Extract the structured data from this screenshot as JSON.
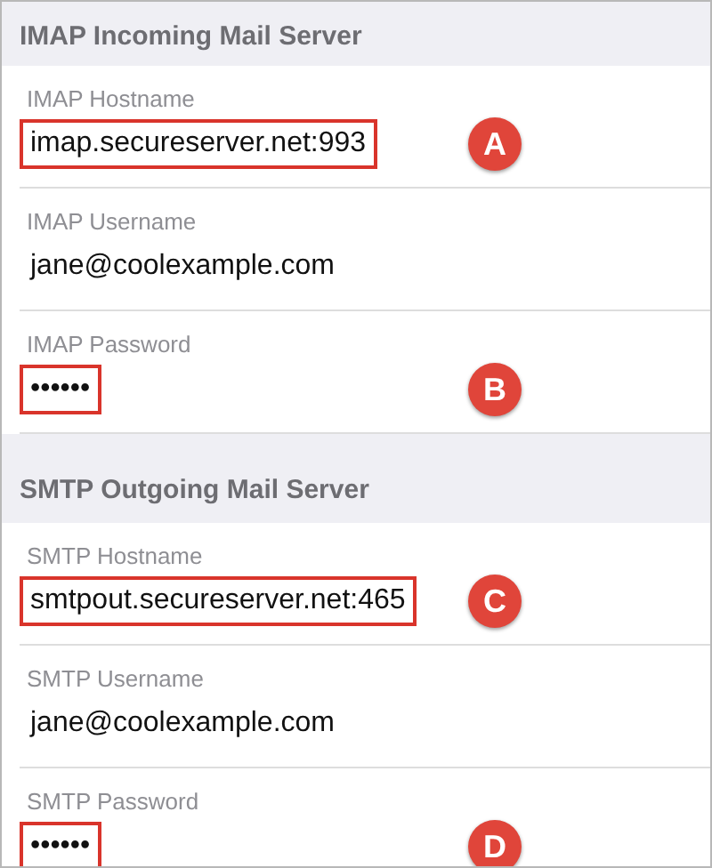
{
  "sections": [
    {
      "title": "IMAP Incoming Mail Server",
      "fields": [
        {
          "label": "IMAP Hostname",
          "value": "imap.secureserver.net:993",
          "highlighted": true,
          "callout": "A"
        },
        {
          "label": "IMAP Username",
          "value": "jane@coolexample.com",
          "highlighted": false
        },
        {
          "label": "IMAP Password",
          "value": "••••••",
          "highlighted": true,
          "callout": "B"
        }
      ]
    },
    {
      "title": "SMTP Outgoing Mail Server",
      "fields": [
        {
          "label": "SMTP Hostname",
          "value": "smtpout.secureserver.net:465",
          "highlighted": true,
          "callout": "C"
        },
        {
          "label": "SMTP Username",
          "value": "jane@coolexample.com",
          "highlighted": false
        },
        {
          "label": "SMTP Password",
          "value": "••••••",
          "highlighted": true,
          "callout": "D"
        }
      ]
    }
  ]
}
